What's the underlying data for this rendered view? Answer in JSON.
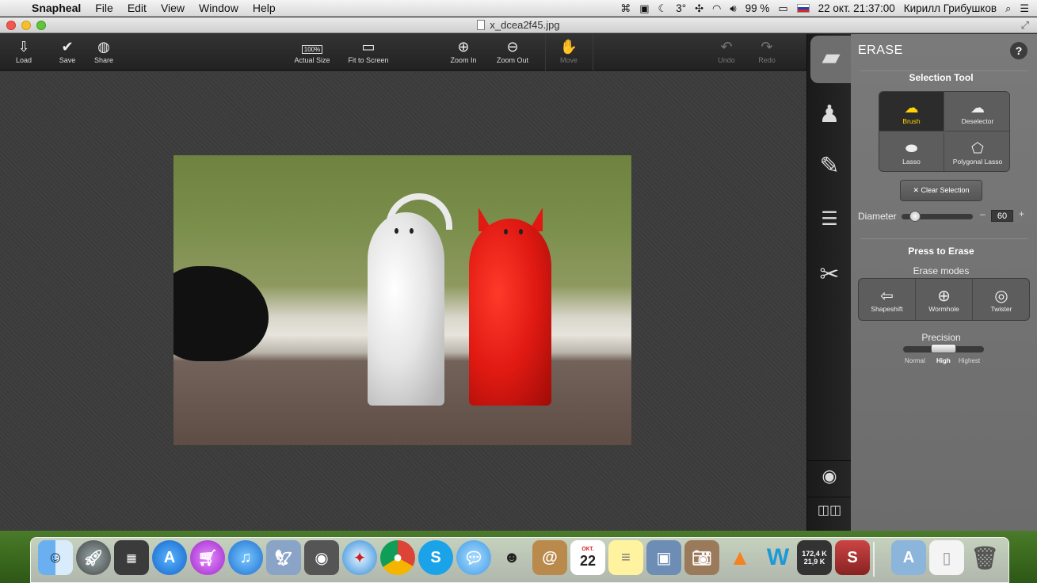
{
  "menubar": {
    "app_name": "Snapheal",
    "menus": [
      "File",
      "Edit",
      "View",
      "Window",
      "Help"
    ],
    "status": {
      "temperature": "3°",
      "battery": "99 %",
      "datetime": "22 окт.  21:37:00",
      "user": "Кирилл Грибушков"
    }
  },
  "window": {
    "title": "x_dcea2f45.jpg"
  },
  "toolbar": {
    "load": "Load",
    "save": "Save",
    "share": "Share",
    "actual_size": "Actual Size",
    "actual_size_badge": "100%",
    "fit_to_screen": "Fit to Screen",
    "zoom_in": "Zoom In",
    "zoom_out": "Zoom Out",
    "move": "Move",
    "undo": "Undo",
    "redo": "Redo"
  },
  "panel": {
    "title": "ERASE",
    "help": "?",
    "selection_tool_heading": "Selection Tool",
    "selection_tools": [
      {
        "label": "Brush",
        "icon": "brush-plus-icon",
        "active": true
      },
      {
        "label": "Deselector",
        "icon": "deselector-minus-icon",
        "active": false
      },
      {
        "label": "Lasso",
        "icon": "lasso-icon",
        "active": false
      },
      {
        "label": "Polygonal Lasso",
        "icon": "polygonal-lasso-icon",
        "active": false
      }
    ],
    "clear_selection": "✕ Clear Selection",
    "diameter_label": "Diameter",
    "diameter_value": "60",
    "diameter_minus": "–",
    "diameter_plus": "+",
    "press_to_erase": "Press to Erase",
    "erase_modes_label": "Erase modes",
    "erase_modes": [
      {
        "label": "Shapeshift",
        "icon": "shapeshift-icon"
      },
      {
        "label": "Wormhole",
        "icon": "wormhole-icon"
      },
      {
        "label": "Twister",
        "icon": "twister-icon"
      }
    ],
    "precision_label": "Precision",
    "precision_options": [
      "Normal",
      "High",
      "Highest"
    ],
    "precision_selected": "High"
  },
  "tool_column": [
    "eraser-icon",
    "stamp-icon",
    "retouch-brush-icon",
    "adjust-sliders-icon",
    "crop-scissors-icon",
    "eye-icon",
    "compare-view-icon"
  ],
  "dock": {
    "calendar_month": "ОКТ.",
    "calendar_day": "22",
    "net_up": "172,4 K",
    "net_down": "21,9 K"
  },
  "colors": {
    "accent_active": "#ffd400",
    "panel_bg": "#737373",
    "toolbar_bg": "#2a2a2a"
  }
}
